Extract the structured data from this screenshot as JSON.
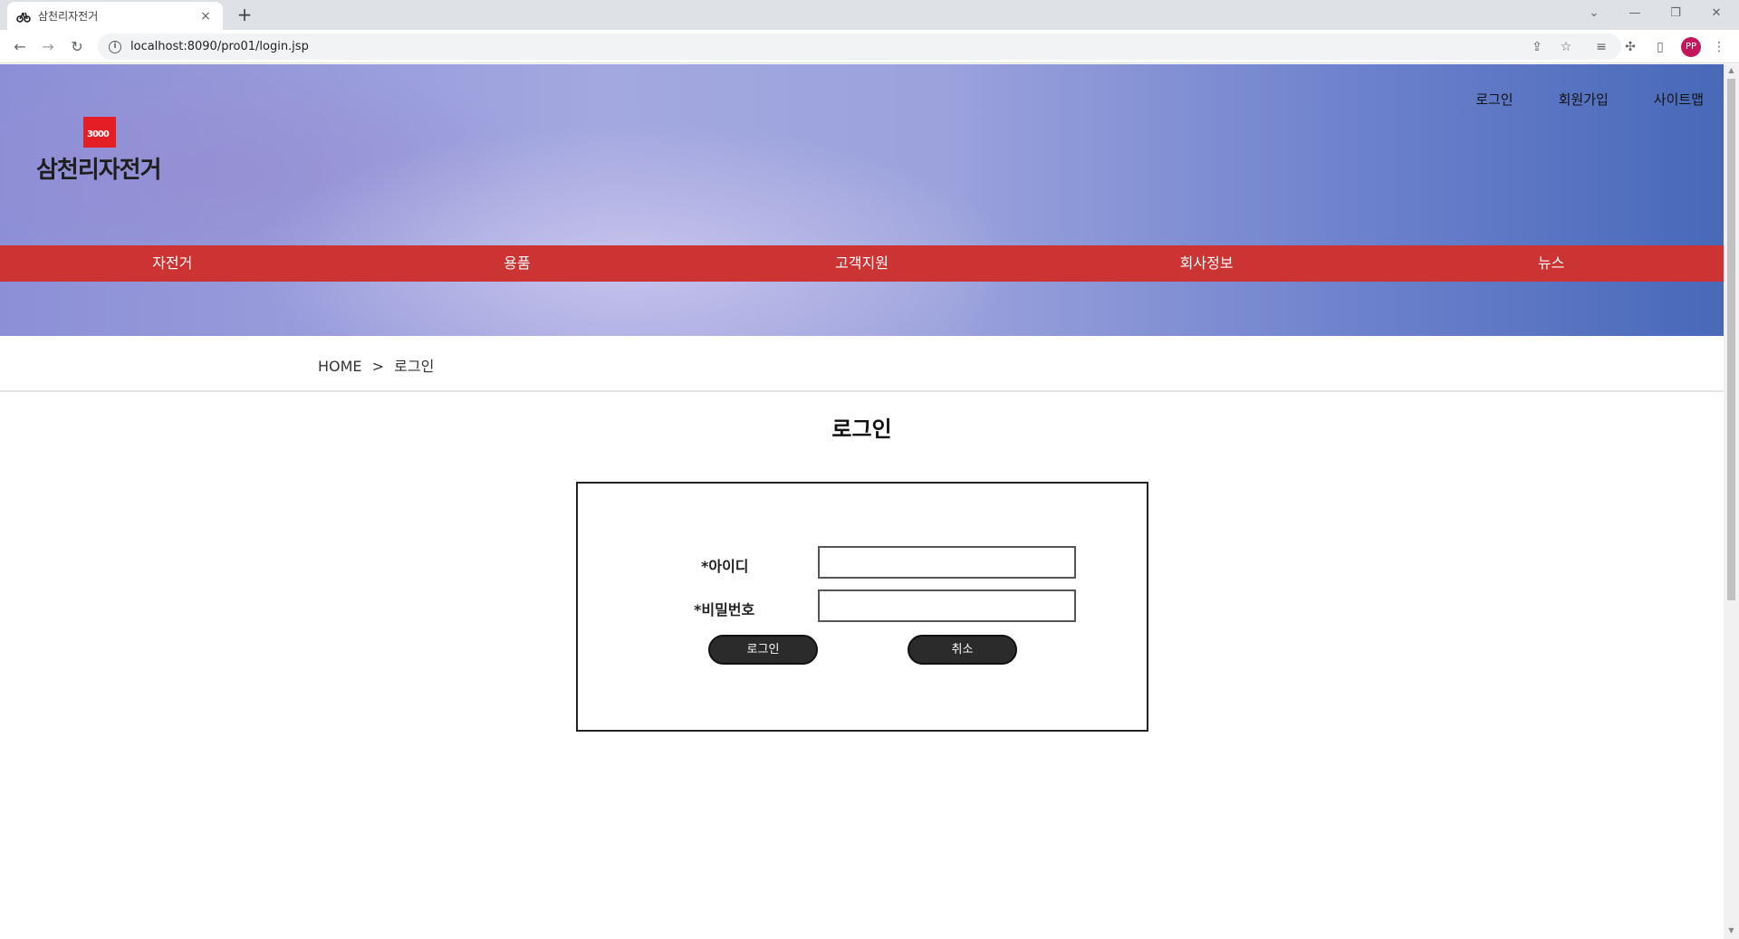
{
  "browser": {
    "tab_title": "삼천리자전거",
    "new_tab": "+",
    "close_tab": "×",
    "url": "localhost:8090/pro01/login.jsp",
    "profile_initials": "PP",
    "profile_color": "#c2185b"
  },
  "header": {
    "logo_text": "삼천리자전거",
    "logo_mark": "3000",
    "brand_color": "#e31e24",
    "links": [
      "로그인",
      "회원가입",
      "사이트맵"
    ]
  },
  "nav": {
    "color": "#cc3333",
    "items": [
      "자전거",
      "용품",
      "고객지원",
      "회사정보",
      "뉴스"
    ]
  },
  "breadcrumb": {
    "home": "HOME",
    "separator": ">",
    "current": "로그인"
  },
  "main": {
    "title": "로그인",
    "form": {
      "id_label": "*아이디",
      "id_value": "",
      "password_label": "*비밀번호",
      "password_value": "",
      "login_button": "로그인",
      "cancel_button": "취소"
    }
  }
}
